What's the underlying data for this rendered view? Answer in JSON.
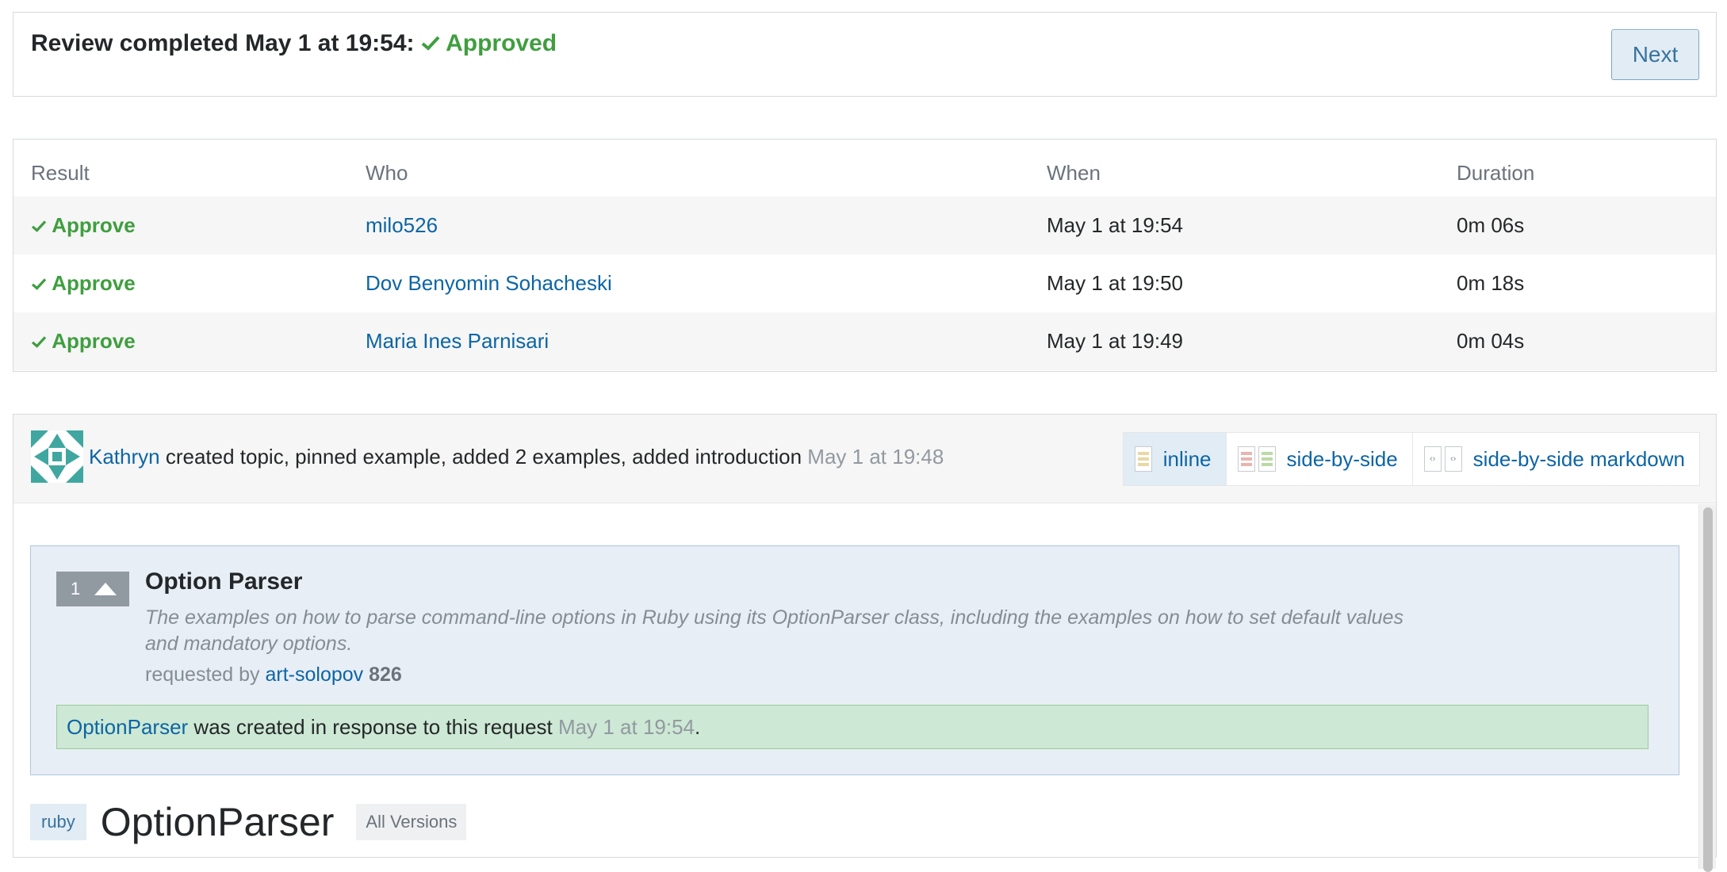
{
  "review": {
    "prefix": "Review completed May 1 at 19:54:",
    "status": "Approved",
    "next_label": "Next"
  },
  "reviews_table": {
    "headers": [
      "Result",
      "Who",
      "When",
      "Duration"
    ],
    "rows": [
      {
        "result": "Approve",
        "who": "milo526",
        "when": "May 1 at 19:54",
        "duration": "0m 06s"
      },
      {
        "result": "Approve",
        "who": "Dov Benyomin Sohacheski",
        "when": "May 1 at 19:50",
        "duration": "0m 18s"
      },
      {
        "result": "Approve",
        "who": "Maria Ines Parnisari",
        "when": "May 1 at 19:49",
        "duration": "0m 04s"
      }
    ]
  },
  "revision": {
    "user": "Kathryn",
    "action": "created topic, pinned example, added 2 examples, added introduction",
    "time": "May 1 at 19:48",
    "tabs": {
      "inline": "inline",
      "side_by_side": "side-by-side",
      "side_by_side_md": "side-by-side markdown"
    }
  },
  "request": {
    "votes": "1",
    "title": "Option Parser",
    "description": "The examples on how to parse command-line options in Ruby using its OptionParser class, including the examples on how to set default values and mandatory options.",
    "requested_by_label": "requested by",
    "requester": "art-solopov",
    "reputation": "826",
    "created_link": "OptionParser",
    "created_text": "was created in response to this request",
    "created_time": "May 1 at 19:54",
    "created_end": "."
  },
  "topic": {
    "tag": "ruby",
    "title": "OptionParser",
    "versions": "All Versions"
  },
  "colors": {
    "approve_green": "#3f9e3f",
    "link_blue": "#0c65a5",
    "request_bg": "#e8eef5",
    "created_bg": "#cde8d4"
  },
  "icons": {
    "check": "checkmark-icon",
    "vote": "upvote-arrow-icon",
    "doc": "document-icon"
  }
}
